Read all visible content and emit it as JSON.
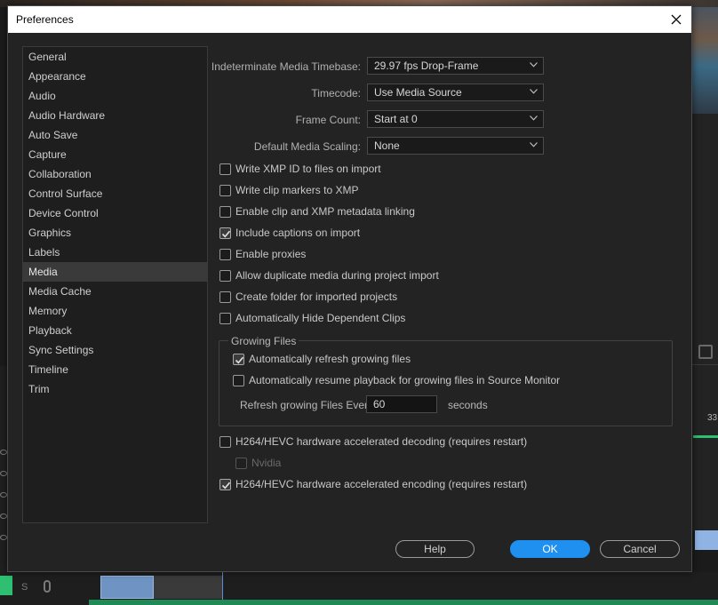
{
  "dialog": {
    "title": "Preferences"
  },
  "sidebar": {
    "items": [
      {
        "label": "General"
      },
      {
        "label": "Appearance"
      },
      {
        "label": "Audio"
      },
      {
        "label": "Audio Hardware"
      },
      {
        "label": "Auto Save"
      },
      {
        "label": "Capture"
      },
      {
        "label": "Collaboration"
      },
      {
        "label": "Control Surface"
      },
      {
        "label": "Device Control"
      },
      {
        "label": "Graphics"
      },
      {
        "label": "Labels"
      },
      {
        "label": "Media"
      },
      {
        "label": "Media Cache"
      },
      {
        "label": "Memory"
      },
      {
        "label": "Playback"
      },
      {
        "label": "Sync Settings"
      },
      {
        "label": "Timeline"
      },
      {
        "label": "Trim"
      }
    ],
    "selected": "Media"
  },
  "media": {
    "fields": [
      {
        "label": "Indeterminate Media Timebase:",
        "value": "29.97 fps Drop-Frame"
      },
      {
        "label": "Timecode:",
        "value": "Use Media Source"
      },
      {
        "label": "Frame Count:",
        "value": "Start at 0"
      },
      {
        "label": "Default Media Scaling:",
        "value": "None"
      }
    ],
    "checkboxes": [
      {
        "label": "Write XMP ID to files on import",
        "checked": false
      },
      {
        "label": "Write clip markers to XMP",
        "checked": false
      },
      {
        "label": "Enable clip and XMP metadata linking",
        "checked": false
      },
      {
        "label": "Include captions on import",
        "checked": true
      },
      {
        "label": "Enable proxies",
        "checked": false
      },
      {
        "label": "Allow duplicate media during project import",
        "checked": false
      },
      {
        "label": "Create folder for imported projects",
        "checked": false
      },
      {
        "label": "Automatically Hide Dependent Clips",
        "checked": false
      }
    ],
    "growing_files": {
      "legend": "Growing Files",
      "auto_refresh": {
        "label": "Automatically refresh growing files",
        "checked": true
      },
      "auto_resume": {
        "label": "Automatically resume playback for growing files in Source Monitor",
        "checked": false
      },
      "refresh_label": "Refresh growing Files Every",
      "refresh_value": "60",
      "seconds_label": "seconds"
    },
    "hw_decoding": {
      "label": "H264/HEVC hardware accelerated decoding (requires restart)",
      "checked": false
    },
    "nvidia": {
      "label": "Nvidia",
      "checked": false,
      "disabled": true
    },
    "hw_encoding": {
      "label": "H264/HEVC hardware accelerated encoding (requires restart)",
      "checked": true
    }
  },
  "buttons": {
    "help": "Help",
    "ok": "OK",
    "cancel": "Cancel"
  },
  "background": {
    "timeline_number": "33",
    "track_label": "S"
  },
  "colors": {
    "accent": "#1f8ff0",
    "dialog_bg": "#232323",
    "sidebar_selected": "#3a3a3a"
  }
}
